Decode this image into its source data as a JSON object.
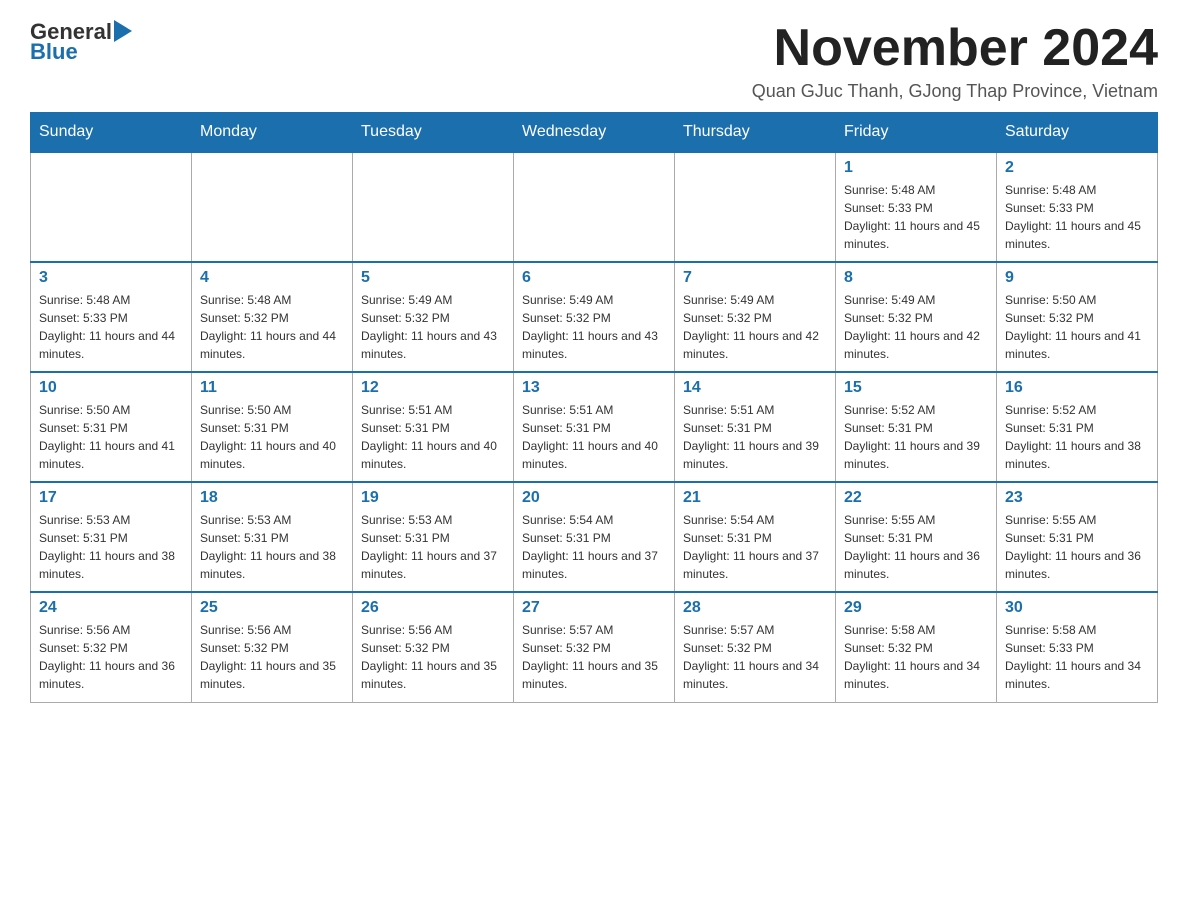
{
  "logo": {
    "general": "General",
    "arrow_icon": "▶",
    "blue": "Blue"
  },
  "header": {
    "title": "November 2024",
    "subtitle": "Quan GJuc Thanh, GJong Thap Province, Vietnam"
  },
  "days_of_week": [
    "Sunday",
    "Monday",
    "Tuesday",
    "Wednesday",
    "Thursday",
    "Friday",
    "Saturday"
  ],
  "weeks": [
    {
      "days": [
        {
          "number": "",
          "info": ""
        },
        {
          "number": "",
          "info": ""
        },
        {
          "number": "",
          "info": ""
        },
        {
          "number": "",
          "info": ""
        },
        {
          "number": "",
          "info": ""
        },
        {
          "number": "1",
          "info": "Sunrise: 5:48 AM\nSunset: 5:33 PM\nDaylight: 11 hours and 45 minutes."
        },
        {
          "number": "2",
          "info": "Sunrise: 5:48 AM\nSunset: 5:33 PM\nDaylight: 11 hours and 45 minutes."
        }
      ]
    },
    {
      "days": [
        {
          "number": "3",
          "info": "Sunrise: 5:48 AM\nSunset: 5:33 PM\nDaylight: 11 hours and 44 minutes."
        },
        {
          "number": "4",
          "info": "Sunrise: 5:48 AM\nSunset: 5:32 PM\nDaylight: 11 hours and 44 minutes."
        },
        {
          "number": "5",
          "info": "Sunrise: 5:49 AM\nSunset: 5:32 PM\nDaylight: 11 hours and 43 minutes."
        },
        {
          "number": "6",
          "info": "Sunrise: 5:49 AM\nSunset: 5:32 PM\nDaylight: 11 hours and 43 minutes."
        },
        {
          "number": "7",
          "info": "Sunrise: 5:49 AM\nSunset: 5:32 PM\nDaylight: 11 hours and 42 minutes."
        },
        {
          "number": "8",
          "info": "Sunrise: 5:49 AM\nSunset: 5:32 PM\nDaylight: 11 hours and 42 minutes."
        },
        {
          "number": "9",
          "info": "Sunrise: 5:50 AM\nSunset: 5:32 PM\nDaylight: 11 hours and 41 minutes."
        }
      ]
    },
    {
      "days": [
        {
          "number": "10",
          "info": "Sunrise: 5:50 AM\nSunset: 5:31 PM\nDaylight: 11 hours and 41 minutes."
        },
        {
          "number": "11",
          "info": "Sunrise: 5:50 AM\nSunset: 5:31 PM\nDaylight: 11 hours and 40 minutes."
        },
        {
          "number": "12",
          "info": "Sunrise: 5:51 AM\nSunset: 5:31 PM\nDaylight: 11 hours and 40 minutes."
        },
        {
          "number": "13",
          "info": "Sunrise: 5:51 AM\nSunset: 5:31 PM\nDaylight: 11 hours and 40 minutes."
        },
        {
          "number": "14",
          "info": "Sunrise: 5:51 AM\nSunset: 5:31 PM\nDaylight: 11 hours and 39 minutes."
        },
        {
          "number": "15",
          "info": "Sunrise: 5:52 AM\nSunset: 5:31 PM\nDaylight: 11 hours and 39 minutes."
        },
        {
          "number": "16",
          "info": "Sunrise: 5:52 AM\nSunset: 5:31 PM\nDaylight: 11 hours and 38 minutes."
        }
      ]
    },
    {
      "days": [
        {
          "number": "17",
          "info": "Sunrise: 5:53 AM\nSunset: 5:31 PM\nDaylight: 11 hours and 38 minutes."
        },
        {
          "number": "18",
          "info": "Sunrise: 5:53 AM\nSunset: 5:31 PM\nDaylight: 11 hours and 38 minutes."
        },
        {
          "number": "19",
          "info": "Sunrise: 5:53 AM\nSunset: 5:31 PM\nDaylight: 11 hours and 37 minutes."
        },
        {
          "number": "20",
          "info": "Sunrise: 5:54 AM\nSunset: 5:31 PM\nDaylight: 11 hours and 37 minutes."
        },
        {
          "number": "21",
          "info": "Sunrise: 5:54 AM\nSunset: 5:31 PM\nDaylight: 11 hours and 37 minutes."
        },
        {
          "number": "22",
          "info": "Sunrise: 5:55 AM\nSunset: 5:31 PM\nDaylight: 11 hours and 36 minutes."
        },
        {
          "number": "23",
          "info": "Sunrise: 5:55 AM\nSunset: 5:31 PM\nDaylight: 11 hours and 36 minutes."
        }
      ]
    },
    {
      "days": [
        {
          "number": "24",
          "info": "Sunrise: 5:56 AM\nSunset: 5:32 PM\nDaylight: 11 hours and 36 minutes."
        },
        {
          "number": "25",
          "info": "Sunrise: 5:56 AM\nSunset: 5:32 PM\nDaylight: 11 hours and 35 minutes."
        },
        {
          "number": "26",
          "info": "Sunrise: 5:56 AM\nSunset: 5:32 PM\nDaylight: 11 hours and 35 minutes."
        },
        {
          "number": "27",
          "info": "Sunrise: 5:57 AM\nSunset: 5:32 PM\nDaylight: 11 hours and 35 minutes."
        },
        {
          "number": "28",
          "info": "Sunrise: 5:57 AM\nSunset: 5:32 PM\nDaylight: 11 hours and 34 minutes."
        },
        {
          "number": "29",
          "info": "Sunrise: 5:58 AM\nSunset: 5:32 PM\nDaylight: 11 hours and 34 minutes."
        },
        {
          "number": "30",
          "info": "Sunrise: 5:58 AM\nSunset: 5:33 PM\nDaylight: 11 hours and 34 minutes."
        }
      ]
    }
  ]
}
